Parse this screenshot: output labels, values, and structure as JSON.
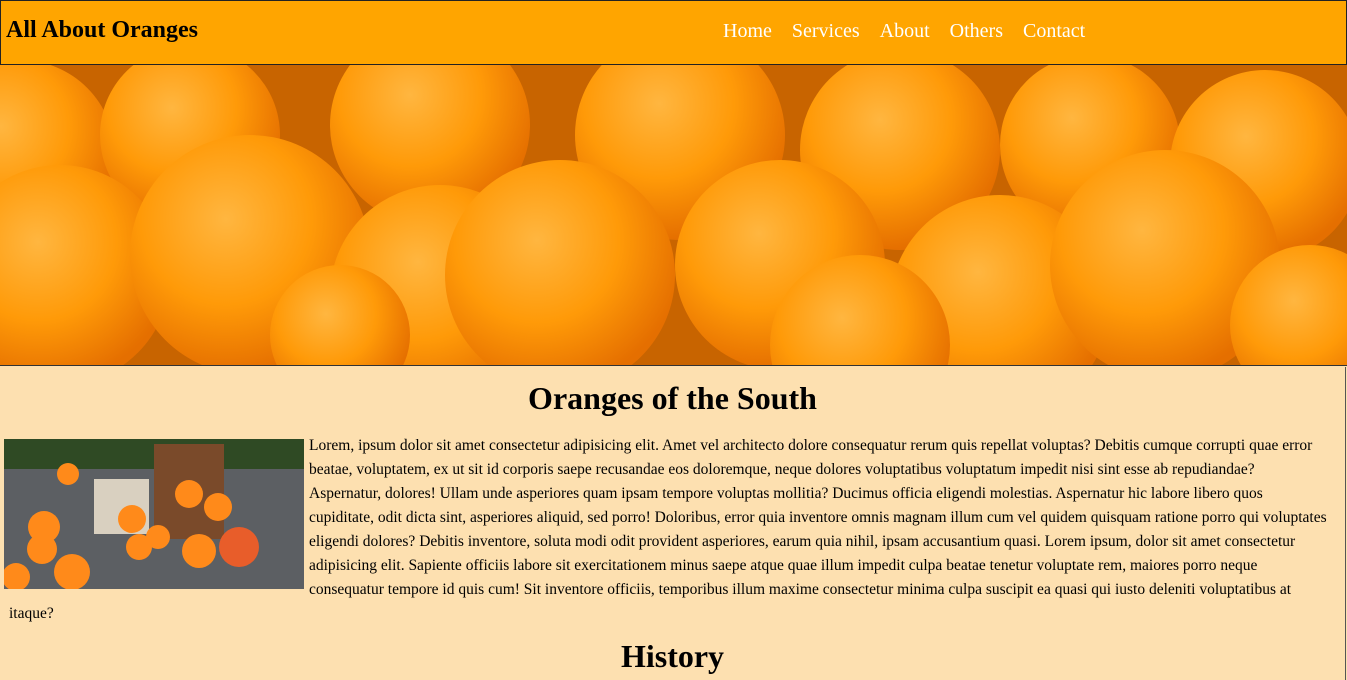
{
  "header": {
    "brand": "All About Oranges",
    "nav": [
      "Home",
      "Services",
      "About",
      "Others",
      "Contact"
    ]
  },
  "hero": {
    "image": "oranges-pile-photo"
  },
  "main": {
    "section1_title": "Oranges of the South",
    "thumbnail": "oranges-basket-photo",
    "paragraph": "Lorem, ipsum dolor sit amet consectetur adipisicing elit. Amet vel architecto dolore consequatur rerum quis repellat voluptas? Debitis cumque corrupti quae error beatae, voluptatem, ex ut sit id corporis saepe recusandae eos doloremque, neque dolores voluptatibus voluptatum impedit nisi sint esse ab repudiandae? Aspernatur, dolores! Ullam unde asperiores quam ipsam tempore voluptas mollitia? Ducimus officia eligendi molestias. Aspernatur hic labore libero quos cupiditate, odit dicta sint, asperiores aliquid, sed porro! Doloribus, error quia inventore omnis magnam illum cum vel quidem quisquam ratione porro qui voluptates eligendi dolores? Debitis inventore, soluta modi odit provident asperiores, earum quia nihil, ipsam accusantium quasi. Lorem ipsum, dolor sit amet consectetur adipisicing elit. Sapiente officiis labore sit exercitationem minus saepe atque quae illum impedit culpa beatae tenetur voluptate rem, maiores porro neque consequatur tempore id quis cum! Sit inventore officiis, temporibus illum maxime consectetur minima culpa suscipit ea quasi qui iusto deleniti voluptatibus at itaque?",
    "section2_title": "History"
  },
  "colors": {
    "header_bg": "#ffa500",
    "page_bg": "#fde0b0",
    "nav_text": "#ffffff"
  }
}
